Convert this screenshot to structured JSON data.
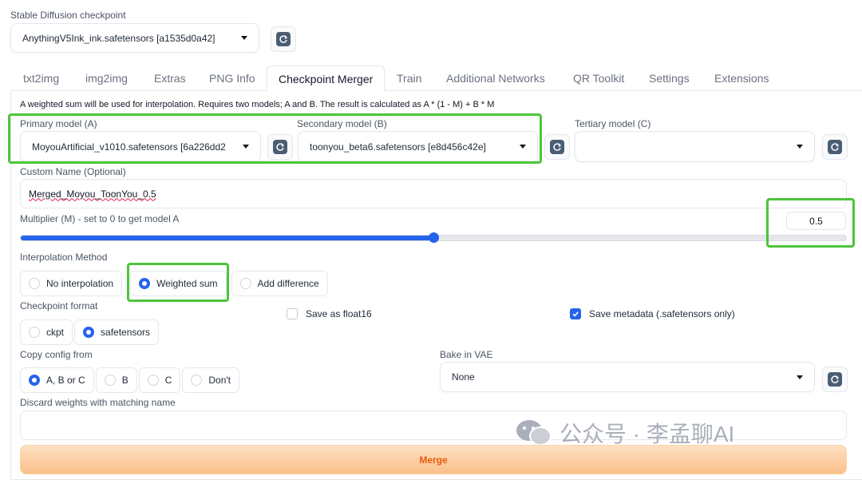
{
  "checkpoint": {
    "label": "Stable Diffusion checkpoint",
    "value": "AnythingV5Ink_ink.safetensors [a1535d0a42]"
  },
  "tabs": [
    "txt2img",
    "img2img",
    "Extras",
    "PNG Info",
    "Checkpoint Merger",
    "Train",
    "Additional Networks",
    "QR Toolkit",
    "Settings",
    "Extensions"
  ],
  "active_tab": "Checkpoint Merger",
  "merger": {
    "description": "A weighted sum will be used for interpolation. Requires two models; A and B. The result is calculated as A * (1 - M) + B * M",
    "primary": {
      "label": "Primary model (A)",
      "value": "MoyouArtificial_v1010.safetensors [6a226dd2"
    },
    "secondary": {
      "label": "Secondary model (B)",
      "value": "toonyou_beta6.safetensors [e8d456c42e]"
    },
    "tertiary": {
      "label": "Tertiary model (C)",
      "value": ""
    },
    "custom_name": {
      "label": "Custom Name (Optional)",
      "value": "Merged_Moyou_ToonYou_0.5"
    },
    "multiplier": {
      "label": "Multiplier (M) - set to 0 to get model A",
      "value": "0.5",
      "fraction": 0.5
    },
    "interpolation": {
      "label": "Interpolation Method",
      "options": [
        "No interpolation",
        "Weighted sum",
        "Add difference"
      ],
      "selected": "Weighted sum"
    },
    "format": {
      "label": "Checkpoint format",
      "options": [
        "ckpt",
        "safetensors"
      ],
      "selected": "safetensors"
    },
    "save_float16": {
      "label": "Save as float16",
      "checked": false
    },
    "save_metadata": {
      "label": "Save metadata (.safetensors only)",
      "checked": true
    },
    "copy_config": {
      "label": "Copy config from",
      "options": [
        "A, B or C",
        "B",
        "C",
        "Don't"
      ],
      "selected": "A, B or C"
    },
    "bake_vae": {
      "label": "Bake in VAE",
      "value": "None"
    },
    "discard": {
      "label": "Discard weights with matching name",
      "value": ""
    },
    "merge_button": "Merge"
  },
  "watermark": "公众号 · 李孟聊AI",
  "colors": {
    "accent": "#2563eb",
    "highlight": "#4cc53a",
    "merge_text": "#ea580c"
  }
}
